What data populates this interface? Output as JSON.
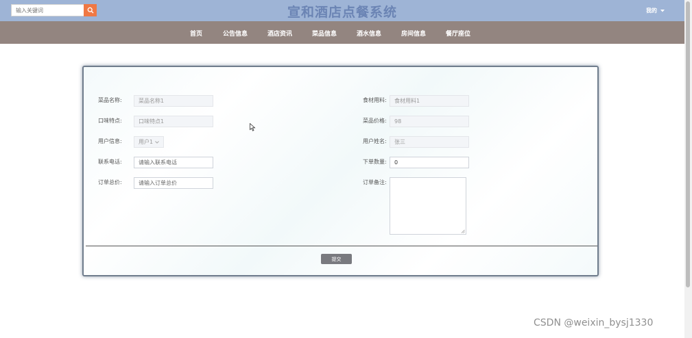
{
  "header": {
    "search_placeholder": "输入关键词",
    "title": "宣和酒店点餐系统",
    "user_menu": "我的"
  },
  "nav": {
    "items": [
      "首页",
      "公告信息",
      "酒店资讯",
      "菜品信息",
      "酒水信息",
      "房间信息",
      "餐厅座位"
    ]
  },
  "form": {
    "dish_name": {
      "label": "菜品名称:",
      "value": "菜品名称1"
    },
    "ingredients": {
      "label": "食材用料:",
      "value": "食材用料1"
    },
    "taste": {
      "label": "口味特点:",
      "value": "口味特点1"
    },
    "price": {
      "label": "菜品价格:",
      "value": "98"
    },
    "user_info": {
      "label": "用户信息:",
      "value": "用户1"
    },
    "user_name": {
      "label": "用户姓名:",
      "value": "张三"
    },
    "phone": {
      "label": "联系电话:",
      "placeholder": "请输入联系电话"
    },
    "quantity": {
      "label": "下单数量:",
      "value": "0"
    },
    "total": {
      "label": "订单总价:",
      "placeholder": "请输入订单总价"
    },
    "remark": {
      "label": "订单备注:"
    },
    "submit_label": "提交"
  },
  "watermark": "CSDN @weixin_bysj1330",
  "colors": {
    "topbar": "#9eb4d6",
    "navbar": "#938580",
    "search_button": "#f07844",
    "title": "#6b84b4",
    "submit_button": "#797a7f"
  }
}
